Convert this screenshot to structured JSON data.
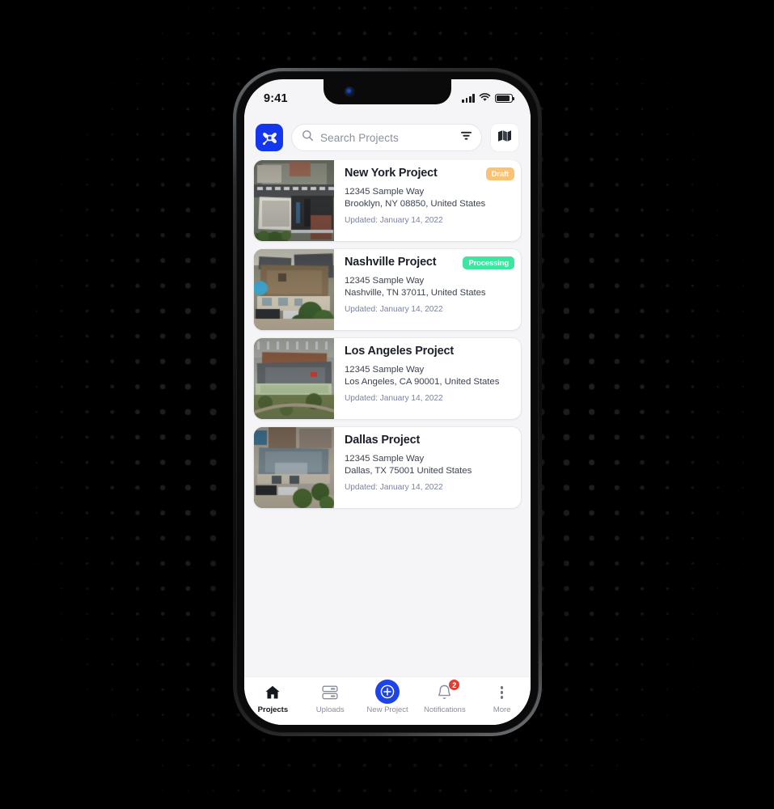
{
  "statusbar": {
    "time": "9:41",
    "signal_icon": "cellular-signal-icon",
    "wifi_icon": "wifi-icon",
    "battery_icon": "battery-icon"
  },
  "toolbar": {
    "app_logo_icon": "drone-propeller-logo-icon",
    "search_placeholder": "Search Projects",
    "search_value": "",
    "search_icon": "search-icon",
    "filter_icon": "filter-icon",
    "map_icon": "map-icon"
  },
  "projects": [
    {
      "title": "New York Project",
      "address1": "12345 Sample Way",
      "address2": "Brooklyn, NY 08850, United States",
      "updated": "Updated: January 14, 2022",
      "badge": "Draft",
      "badge_type": "draft",
      "badge_color": "#fbc273",
      "thumb_kind": "neighborhood"
    },
    {
      "title": "Nashville Project",
      "address1": "12345 Sample Way",
      "address2": "Nashville, TN 37011, United States",
      "updated": "Updated: January 14, 2022",
      "badge": "Processing",
      "badge_type": "processing",
      "badge_color": "#3ce6a0",
      "thumb_kind": "brownroof"
    },
    {
      "title": "Los Angeles Project",
      "address1": "12345 Sample Way",
      "address2": "Los Angeles, CA 90001, United States",
      "updated": "Updated: January 14, 2022",
      "badge": "",
      "badge_type": "none",
      "badge_color": "",
      "thumb_kind": "commercial"
    },
    {
      "title": "Dallas Project",
      "address1": "12345 Sample Way",
      "address2": "Dallas, TX 75001 United States",
      "updated": "Updated: January 14, 2022",
      "badge": "",
      "badge_type": "none",
      "badge_color": "",
      "thumb_kind": "grayroof"
    }
  ],
  "tabbar": {
    "items": [
      {
        "label": "Projects",
        "icon": "home-icon",
        "active": true,
        "badge": ""
      },
      {
        "label": "Uploads",
        "icon": "uploads-icon",
        "active": false,
        "badge": ""
      },
      {
        "label": "New Project",
        "icon": "plus-circle-icon",
        "active": false,
        "badge": ""
      },
      {
        "label": "Notifications",
        "icon": "bell-icon",
        "active": false,
        "badge": "2"
      },
      {
        "label": "More",
        "icon": "kebab-menu-icon",
        "active": false,
        "badge": ""
      }
    ]
  },
  "theme": {
    "brand_blue": "#1337ee",
    "fab_blue": "#1d44e8",
    "badge_red": "#e8392f",
    "screen_bg": "#f5f5f7",
    "card_bg": "#ffffff",
    "title_color": "#1b1f2a",
    "muted_color": "#7b84a0",
    "page_bg": "#000000"
  }
}
